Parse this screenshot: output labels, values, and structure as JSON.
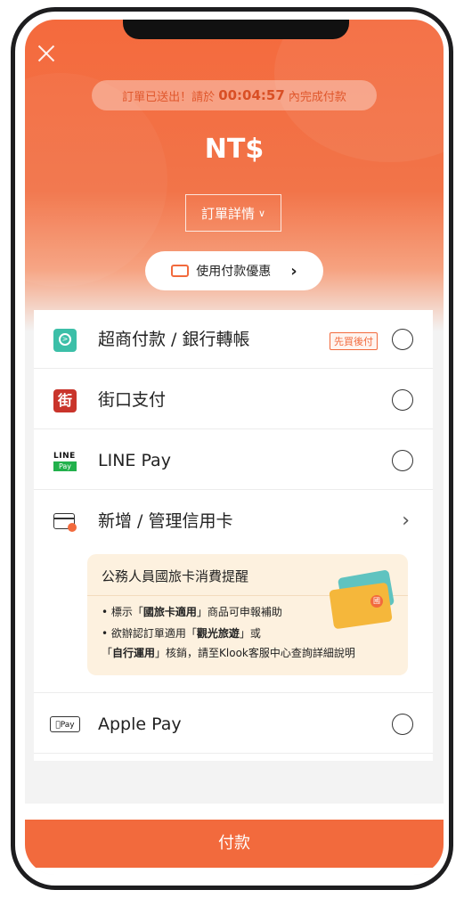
{
  "header": {
    "timer_prefix": "訂單已送出！請於",
    "timer_value": "00:04:57",
    "timer_suffix": "內完成付款",
    "price": "NT$",
    "details_label": "訂單詳情",
    "promo_label": "使用付款優惠"
  },
  "payment_methods": [
    {
      "label": "超商付款 / 銀行轉帳",
      "badge": "先買後付",
      "icon": "convenience-store-icon"
    },
    {
      "label": "街口支付",
      "icon": "jkopay-icon",
      "icon_text": "街"
    },
    {
      "label": "LINE Pay",
      "icon": "line-pay-icon",
      "icon_text_top": "LINE",
      "icon_text_bottom": "Pay"
    },
    {
      "label": "新增 / 管理信用卡",
      "icon": "credit-card-icon"
    },
    {
      "label": "Apple Pay",
      "icon": "apple-pay-icon",
      "icon_text": "Pay"
    }
  ],
  "notice": {
    "title": "公務人員國旅卡消費提醒",
    "line1_prefix": "• 標示「",
    "line1_bold": "國旅卡適用",
    "line1_suffix": "」商品可申報補助",
    "line2_prefix": "• 欲辦認訂單適用「",
    "line2_bold": "觀光旅遊",
    "line2_suffix": "」或",
    "line3_prefix": "「",
    "line3_bold": "自行運用",
    "line3_suffix": "」核銷，請至Klook客服中心查詢詳細說明",
    "seal_text": "國"
  },
  "footer": {
    "pay_label": "付款"
  },
  "colors": {
    "accent": "#f26a3d",
    "store_icon": "#3cbfa8",
    "jko_icon": "#c9342b",
    "line_green": "#22b14c",
    "notice_bg": "#fdf1df"
  }
}
